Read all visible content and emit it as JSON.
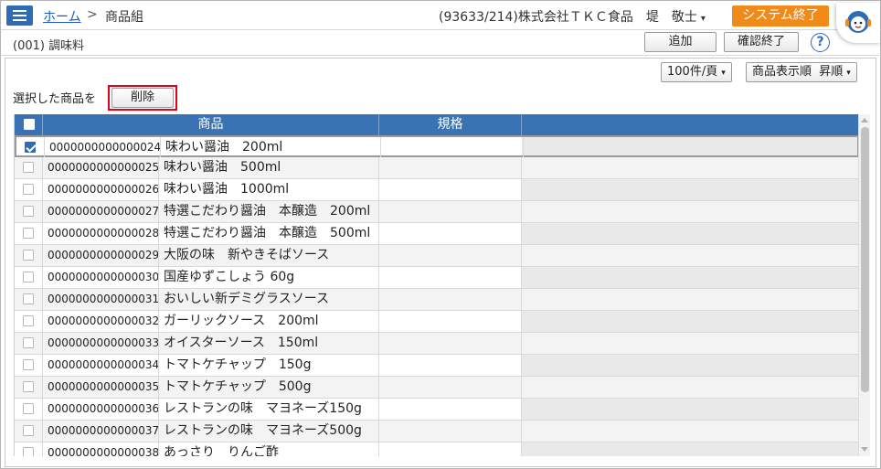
{
  "header": {
    "breadcrumb_home": "ホーム",
    "breadcrumb_sep": ">",
    "breadcrumb_current": "商品組",
    "user": "(93633/214)株式会社ＴＫＣ食品　堤　敬士",
    "user_arrow": "▾",
    "exit_button": "システム終了",
    "accent_color": "#2e6cb5",
    "exit_color": "#f08a18"
  },
  "subheader": {
    "group": "(001) 調味料",
    "add_button": "追加",
    "confirm_button": "確認終了",
    "help": "?"
  },
  "toolbar": {
    "page_size": "100件/頁",
    "sort_field": "商品表示順",
    "sort_order": "昇順",
    "dropdown_arrow": "▾",
    "selected_label": "選択した商品を",
    "delete_button": "削除"
  },
  "table": {
    "columns": [
      "商品",
      "規格"
    ],
    "rows": [
      {
        "code": "0000000000000024",
        "name": "味わい醤油　200ml",
        "checked": true
      },
      {
        "code": "0000000000000025",
        "name": "味わい醤油　500ml",
        "checked": false
      },
      {
        "code": "0000000000000026",
        "name": "味わい醤油　1000ml",
        "checked": false
      },
      {
        "code": "0000000000000027",
        "name": "特選こだわり醤油　本醸造　200ml",
        "checked": false
      },
      {
        "code": "0000000000000028",
        "name": "特選こだわり醤油　本醸造　500ml",
        "checked": false
      },
      {
        "code": "0000000000000029",
        "name": "大阪の味　新やきそばソース",
        "checked": false
      },
      {
        "code": "0000000000000030",
        "name": "国産ゆずこしょう 60g",
        "checked": false
      },
      {
        "code": "0000000000000031",
        "name": "おいしい新デミグラスソース",
        "checked": false
      },
      {
        "code": "0000000000000032",
        "name": "ガーリックソース　200ml",
        "checked": false
      },
      {
        "code": "0000000000000033",
        "name": "オイスターソース　150ml",
        "checked": false
      },
      {
        "code": "0000000000000034",
        "name": "トマトケチャップ　150g",
        "checked": false
      },
      {
        "code": "0000000000000035",
        "name": "トマトケチャップ　500g",
        "checked": false
      },
      {
        "code": "0000000000000036",
        "name": "レストランの味　マヨネーズ150g",
        "checked": false
      },
      {
        "code": "0000000000000037",
        "name": "レストランの味　マヨネーズ500g",
        "checked": false
      },
      {
        "code": "0000000000000038",
        "name": "あっさり　りんご酢",
        "checked": false
      }
    ]
  }
}
